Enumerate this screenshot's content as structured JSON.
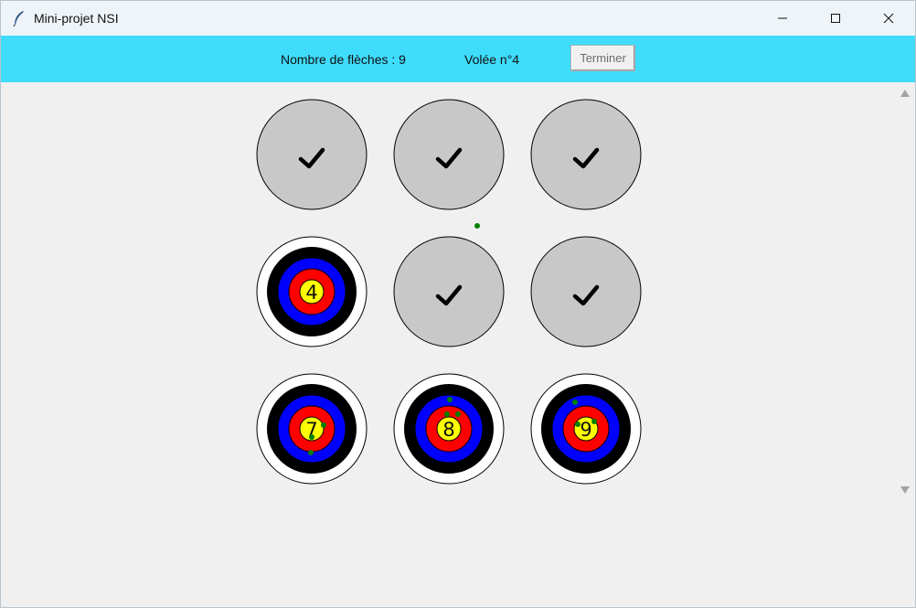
{
  "window": {
    "title": "Mini-projet NSI",
    "icon": "feather-icon",
    "controls": [
      "minimize-icon",
      "maximize-icon",
      "close-icon"
    ]
  },
  "toolbar": {
    "arrows_label": "Nombre de flèches : 9",
    "round_label": "Volée n°4",
    "finish_button": "Terminer"
  },
  "colors": {
    "toolbar_bg": "#3fdcfc",
    "done_target": "#c8c8c8",
    "ring_outer": "#ffffff",
    "ring_black": "#000000",
    "ring_blue": "#0000ff",
    "ring_red": "#ff0000",
    "ring_gold": "#ffff00",
    "arrow_hit": "#008000"
  },
  "targets": [
    {
      "state": "done",
      "icon": "checkmark-icon"
    },
    {
      "state": "done",
      "icon": "checkmark-icon"
    },
    {
      "state": "done",
      "icon": "checkmark-icon"
    },
    {
      "state": "active",
      "number": "4"
    },
    {
      "state": "done",
      "icon": "checkmark-icon"
    },
    {
      "state": "done",
      "icon": "checkmark-icon"
    },
    {
      "state": "active",
      "number": "7"
    },
    {
      "state": "active",
      "number": "8"
    },
    {
      "state": "active",
      "number": "9"
    }
  ]
}
